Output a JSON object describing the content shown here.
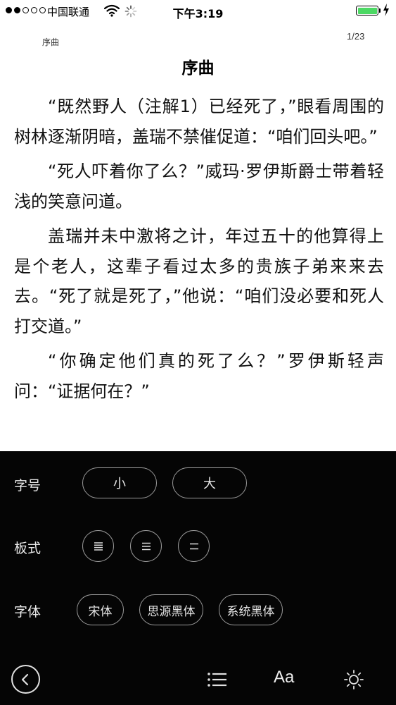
{
  "status_bar": {
    "carrier": "中国联通",
    "time": "下午3:19",
    "signal_bars_filled": 2,
    "signal_bars_total": 5,
    "battery_level": 1.0,
    "colors": {
      "battery": "#4cd964"
    }
  },
  "header": {
    "chapter_small": "序曲",
    "page_counter": "1/23",
    "chapter_title": "序曲"
  },
  "content": {
    "paragraphs": [
      "“既然野人（注解1）已经死了，”眼看周围的树林逐渐阴暗，盖瑞不禁催促道：“咱们回头吧。”",
      "“死人吓着你了么？”威玛·罗伊斯爵士带着轻浅的笑意问道。",
      "盖瑞并未中激将之计，年过五十的他算得上是个老人，这辈子看过太多的贵族子弟来来去去。“死了就是死了，”他说：“咱们没必要和死人打交道。”",
      "“你确定他们真的死了么？”罗伊斯轻声问：“证据何在？”"
    ]
  },
  "settings": {
    "font_size": {
      "label": "字号",
      "small": "小",
      "large": "大"
    },
    "layout": {
      "label": "板式",
      "options": [
        "compact-spacing-icon",
        "medium-spacing-icon",
        "wide-spacing-icon"
      ]
    },
    "typeface": {
      "label": "字体",
      "options": [
        "宋体",
        "思源黑体",
        "系统黑体"
      ]
    },
    "colors": {
      "panel_bg": "#050505",
      "pill_border": "#9a9a9a"
    }
  },
  "toolbar": {
    "back_icon": "chevron-left-icon",
    "toc_icon": "list-icon",
    "font_label": "Aa",
    "brightness_icon": "sun-icon"
  }
}
